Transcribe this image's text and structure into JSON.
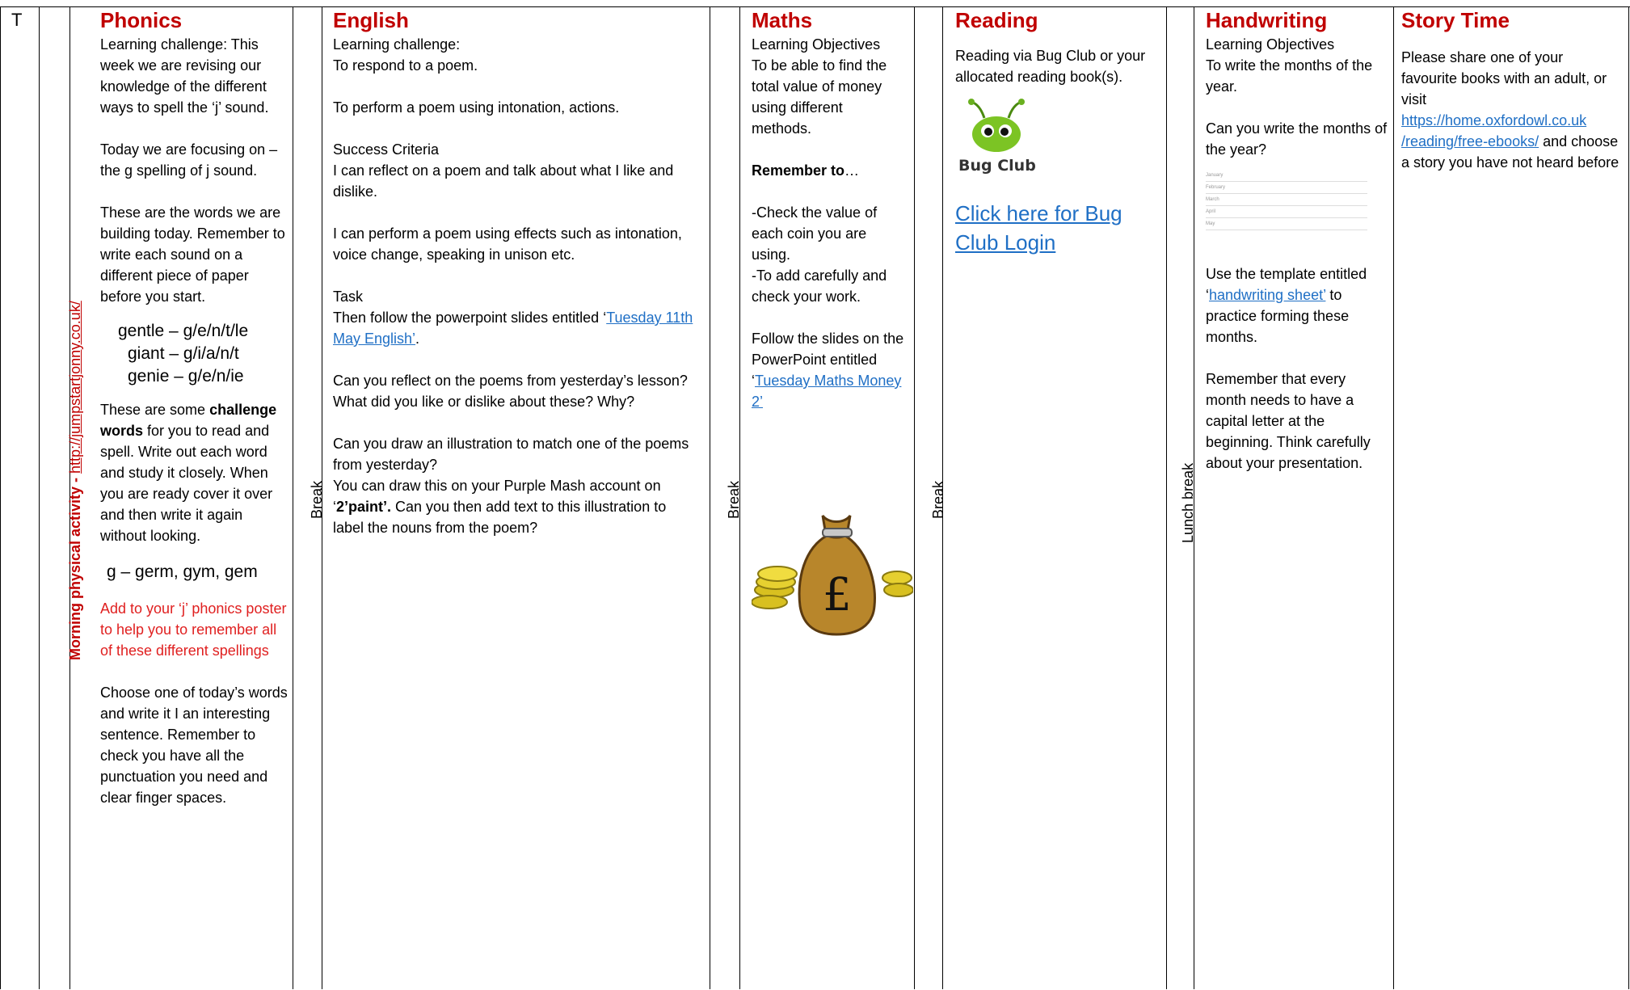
{
  "row_label": "T",
  "morning": {
    "label": "Morning physical activity - ",
    "link": "http://jumpstartjonny.co.uk/"
  },
  "phonics": {
    "title": "Phonics",
    "lc_label": "Learning challenge:",
    "lc_text": " This week we are revising our knowledge of the different ways to spell the ‘j’ sound.",
    "focus_label": "Today we are focusing on –",
    "focus_text": " the g spelling of j sound.",
    "words_intro": "These are the words we are building today. Remember to write each sound on a different piece of paper before you start.",
    "word1": "gentle – g/e/n/t/le",
    "word2": "giant – g/i/a/n/t",
    "word3": "genie – g/e/n/ie",
    "challenge_pre": "These are some ",
    "challenge_bold": "challenge words",
    "challenge_post": " for you to read and spell. Write out each word and study it closely. When you are ready cover it over and then write it again without looking.",
    "challenge_words": "g – germ, gym, gem",
    "poster_note": "Add to your ‘j’ phonics poster to help you to remember all of these different spellings",
    "sentence_task": "Choose one of today’s words and write it I an interesting sentence. Remember to check you have all the punctuation you need and clear finger spaces."
  },
  "break1": "Break",
  "english": {
    "title": "English",
    "lc_label": "Learning challenge:",
    "lc_line1": "To respond to a poem.",
    "lc_line2": "To perform a poem using intonation, actions.",
    "sc_label": "Success Criteria",
    "sc_line1": "I can reflect on a poem and talk about what I like and dislike.",
    "sc_line2": "I can perform a poem using effects such as intonation, voice change, speaking in unison etc.",
    "task_label": "Task",
    "task_pre": "Then follow the powerpoint slides entitled ‘",
    "task_link": "Tuesday 11th May English’",
    "task_post": ".",
    "reflect": "Can you reflect on the poems from yesterday’s lesson? What did you like or dislike about these? Why?",
    "draw1": "Can you draw an illustration to match one of the poems from yesterday?",
    "draw2_pre": "You can draw this on your Purple Mash account on ‘",
    "draw2_bold": "2’paint’.",
    "draw2_post": "  Can you then add text to this illustration to label the nouns from the poem?"
  },
  "break2": "Break",
  "maths": {
    "title": "Maths",
    "lo_label": "Learning Objectives",
    "lo_text": "To be able to find the total value of money using different methods.",
    "remember_label": "Remember to",
    "remember_dots": "…",
    "check1": "-Check the value of each coin you are using.",
    "check2": "-To add carefully and check your work.",
    "follow_pre": "Follow the slides on the PowerPoint entitled ‘",
    "follow_link": "Tuesday Maths Money 2’",
    "bag_symbol": "£"
  },
  "break3": "Break",
  "reading": {
    "title": "Reading",
    "text": "Reading via Bug Club or your allocated reading book(s).",
    "logo_text": "Bug Club",
    "login_link": "Click here for Bug Club Login"
  },
  "lunch": "Lunch break",
  "handwriting": {
    "title": "Handwriting",
    "lo_label": "Learning Objectives",
    "lo_text": "To write the months of the year.",
    "question": "Can you write the months of the year?",
    "sheet_rows": [
      "January",
      "February",
      "March",
      "April",
      "May"
    ],
    "template_pre": "Use the template entitled ‘",
    "template_link": "handwriting sheet’",
    "template_post": " to practice forming these months.",
    "remember": "Remember that every month needs to have a capital letter at the beginning. Think carefully about your presentation."
  },
  "story": {
    "title": "Story Time",
    "text1": "Please share one of your favourite books with an adult, or visit",
    "link1": "https://home.oxfordowl.co.uk",
    "link2": "/reading/free-ebooks/",
    "text2": " and choose a story you have not heard before"
  },
  "colors": {
    "heading": "#c00000",
    "link": "#1f6fc5",
    "note": "#e02020"
  }
}
